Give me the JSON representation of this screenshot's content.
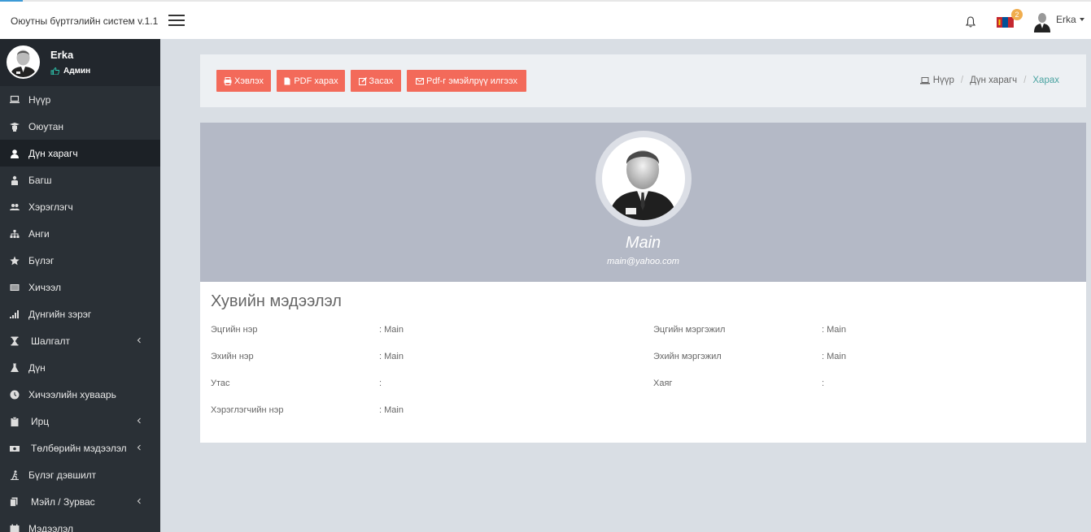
{
  "app": {
    "title": "Оюутны бүртгэлийн систем v.1.1"
  },
  "topbar": {
    "notifications_badge": "2",
    "user_name": "Erka"
  },
  "sidebar": {
    "user": {
      "name": "Erka",
      "role": "Админ"
    },
    "items": [
      {
        "label": "Нүүр",
        "icon": "laptop-icon"
      },
      {
        "label": "Оюутан",
        "icon": "graduate-icon"
      },
      {
        "label": "Дүн харагч",
        "icon": "user-icon",
        "active": true
      },
      {
        "label": "Багш",
        "icon": "teacher-icon"
      },
      {
        "label": "Хэрэглэгч",
        "icon": "users-icon"
      },
      {
        "label": "Анги",
        "icon": "sitemap-icon"
      },
      {
        "label": "Бүлэг",
        "icon": "star-icon"
      },
      {
        "label": "Хичээл",
        "icon": "book-icon"
      },
      {
        "label": "Дүнгийн зэрэг",
        "icon": "signal-icon"
      },
      {
        "label": "Шалгалт",
        "icon": "hourglass-icon",
        "submenu": true
      },
      {
        "label": "Дүн",
        "icon": "flask-icon"
      },
      {
        "label": "Хичээлийн хуваарь",
        "icon": "clock-icon"
      },
      {
        "label": "Ирц",
        "icon": "clipboard-icon",
        "submenu": true
      },
      {
        "label": "Төлбөрийн мэдээлэл",
        "icon": "money-icon",
        "submenu": true
      },
      {
        "label": "Бүлэг дэвшилт",
        "icon": "climb-icon"
      },
      {
        "label": "Мэйл / Зурвас",
        "icon": "mail-icon",
        "submenu": true
      },
      {
        "label": "Мэдээлэл",
        "icon": "calendar-icon"
      }
    ]
  },
  "toolbar": {
    "print": "Хэвлэх",
    "pdf": "PDF харах",
    "edit": "Засах",
    "email_pdf": "Pdf-г эмэйлрүү илгээх"
  },
  "breadcrumb": {
    "home": "Нүүр",
    "parent": "Дүн харагч",
    "current": "Харах"
  },
  "profile": {
    "name": "Main",
    "email": "main@yahoo.com"
  },
  "info": {
    "title": "Хувийн мэдээлэл",
    "rows": [
      {
        "label": "Эцгийн нэр",
        "value": ": Main"
      },
      {
        "label": "Эцгийн мэргэжил",
        "value": ": Main"
      },
      {
        "label": "Эхийн нэр",
        "value": ": Main"
      },
      {
        "label": "Эхийн мэргэжил",
        "value": ": Main"
      },
      {
        "label": "Утас",
        "value": ":"
      },
      {
        "label": "Хаяг",
        "value": ":"
      },
      {
        "label": "Хэрэглэгчийн нэр",
        "value": ": Main"
      }
    ]
  },
  "colors": {
    "sidebar": "#2a3036",
    "button": "#f36a5a",
    "cover": "#b4b9c6",
    "link": "#4aa3a1"
  }
}
